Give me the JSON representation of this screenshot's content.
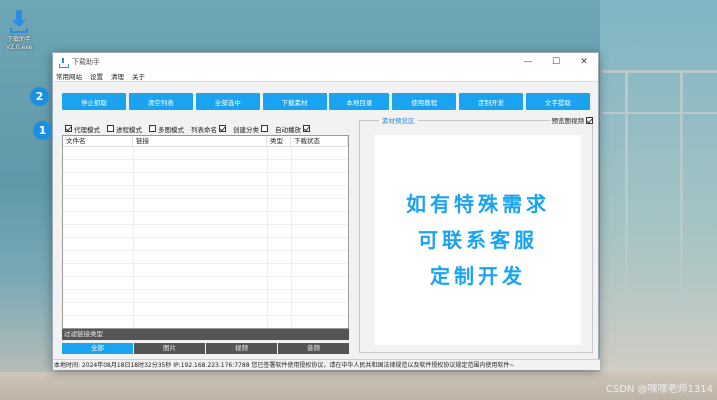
{
  "desktop": {
    "icon_label": "下载助手\nV2.0.exe"
  },
  "window": {
    "title": "下载助手",
    "controls": {
      "minimize": "—",
      "maximize": "☐",
      "close": "✕"
    }
  },
  "menu": [
    "常用网站",
    "设置",
    "清理",
    "关于"
  ],
  "toolbar": [
    {
      "label": "停止抓取",
      "w": 64
    },
    {
      "label": "清空列表",
      "w": 64
    },
    {
      "label": "全部选中",
      "w": 64
    },
    {
      "label": "下载素材",
      "w": 64
    },
    {
      "label": "本地目录",
      "w": 60
    },
    {
      "label": "使用教程",
      "w": 64
    },
    {
      "label": "定制开发",
      "w": 64
    },
    {
      "label": "文字提取",
      "w": 64
    }
  ],
  "options": [
    {
      "label": "代理模式",
      "checked": true,
      "label_first": false
    },
    {
      "label": "进程模式",
      "checked": false,
      "label_first": false
    },
    {
      "label": "多图模式",
      "checked": false,
      "label_first": false
    },
    {
      "label": "列表命名",
      "checked": true,
      "label_first": true
    },
    {
      "label": "创建分类",
      "checked": false,
      "label_first": true
    },
    {
      "label": "自动播放",
      "checked": true,
      "label_first": true
    }
  ],
  "table": {
    "columns": [
      "文件名",
      "链接",
      "类型",
      "下载状态"
    ]
  },
  "filter": {
    "label": "过滤链接类型"
  },
  "tabs": [
    "全部",
    "图片",
    "视频",
    "音频"
  ],
  "active_tab": 0,
  "preview": {
    "legend": "素材预览区",
    "toggle_label": "预览图视频",
    "toggle_checked": true,
    "lines": [
      "如有特殊需求",
      "可联系客服",
      "定制开发"
    ]
  },
  "status": "本地时间: 2024年08月18日18时32分35秒    IP:192.168.223.176:7788 您已签署软件使用授权协议，请在中华人民共和国法律规范以及软件授权协议规定范围内使用软件~",
  "badges": [
    "2",
    "1"
  ],
  "watermark": "CSDN @嘿嘿老师1314"
}
